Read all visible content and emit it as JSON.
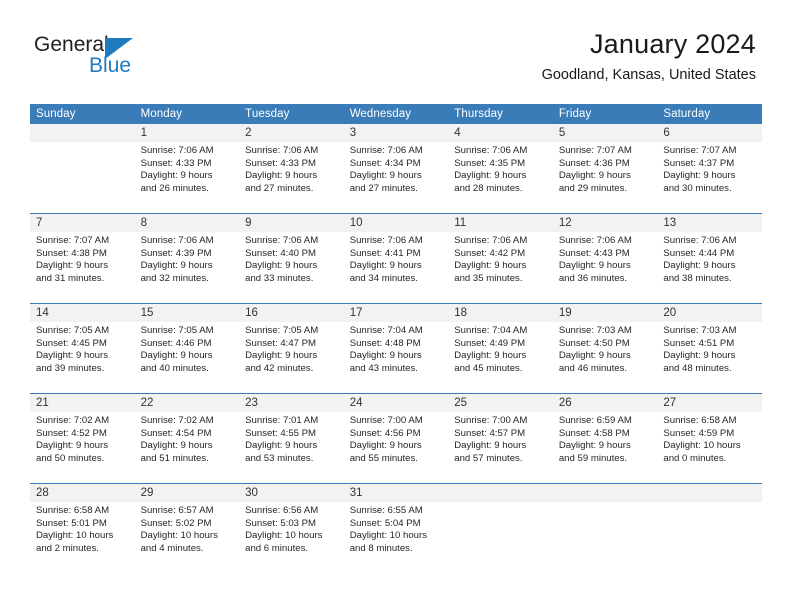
{
  "brand": {
    "name_part1": "General",
    "name_part2": "Blue",
    "accent_color": "#1f7ac0",
    "triangle_icon": "triangle-icon"
  },
  "header": {
    "title": "January 2024",
    "location": "Goodland, Kansas, United States"
  },
  "calendar": {
    "header_bg": "#3a7cb8",
    "daynum_bg": "#f2f2f2",
    "weekdays": [
      "Sunday",
      "Monday",
      "Tuesday",
      "Wednesday",
      "Thursday",
      "Friday",
      "Saturday"
    ],
    "weeks": [
      [
        {
          "day": "",
          "lines": []
        },
        {
          "day": "1",
          "lines": [
            "Sunrise: 7:06 AM",
            "Sunset: 4:33 PM",
            "Daylight: 9 hours",
            "and 26 minutes."
          ]
        },
        {
          "day": "2",
          "lines": [
            "Sunrise: 7:06 AM",
            "Sunset: 4:33 PM",
            "Daylight: 9 hours",
            "and 27 minutes."
          ]
        },
        {
          "day": "3",
          "lines": [
            "Sunrise: 7:06 AM",
            "Sunset: 4:34 PM",
            "Daylight: 9 hours",
            "and 27 minutes."
          ]
        },
        {
          "day": "4",
          "lines": [
            "Sunrise: 7:06 AM",
            "Sunset: 4:35 PM",
            "Daylight: 9 hours",
            "and 28 minutes."
          ]
        },
        {
          "day": "5",
          "lines": [
            "Sunrise: 7:07 AM",
            "Sunset: 4:36 PM",
            "Daylight: 9 hours",
            "and 29 minutes."
          ]
        },
        {
          "day": "6",
          "lines": [
            "Sunrise: 7:07 AM",
            "Sunset: 4:37 PM",
            "Daylight: 9 hours",
            "and 30 minutes."
          ]
        }
      ],
      [
        {
          "day": "7",
          "lines": [
            "Sunrise: 7:07 AM",
            "Sunset: 4:38 PM",
            "Daylight: 9 hours",
            "and 31 minutes."
          ]
        },
        {
          "day": "8",
          "lines": [
            "Sunrise: 7:06 AM",
            "Sunset: 4:39 PM",
            "Daylight: 9 hours",
            "and 32 minutes."
          ]
        },
        {
          "day": "9",
          "lines": [
            "Sunrise: 7:06 AM",
            "Sunset: 4:40 PM",
            "Daylight: 9 hours",
            "and 33 minutes."
          ]
        },
        {
          "day": "10",
          "lines": [
            "Sunrise: 7:06 AM",
            "Sunset: 4:41 PM",
            "Daylight: 9 hours",
            "and 34 minutes."
          ]
        },
        {
          "day": "11",
          "lines": [
            "Sunrise: 7:06 AM",
            "Sunset: 4:42 PM",
            "Daylight: 9 hours",
            "and 35 minutes."
          ]
        },
        {
          "day": "12",
          "lines": [
            "Sunrise: 7:06 AM",
            "Sunset: 4:43 PM",
            "Daylight: 9 hours",
            "and 36 minutes."
          ]
        },
        {
          "day": "13",
          "lines": [
            "Sunrise: 7:06 AM",
            "Sunset: 4:44 PM",
            "Daylight: 9 hours",
            "and 38 minutes."
          ]
        }
      ],
      [
        {
          "day": "14",
          "lines": [
            "Sunrise: 7:05 AM",
            "Sunset: 4:45 PM",
            "Daylight: 9 hours",
            "and 39 minutes."
          ]
        },
        {
          "day": "15",
          "lines": [
            "Sunrise: 7:05 AM",
            "Sunset: 4:46 PM",
            "Daylight: 9 hours",
            "and 40 minutes."
          ]
        },
        {
          "day": "16",
          "lines": [
            "Sunrise: 7:05 AM",
            "Sunset: 4:47 PM",
            "Daylight: 9 hours",
            "and 42 minutes."
          ]
        },
        {
          "day": "17",
          "lines": [
            "Sunrise: 7:04 AM",
            "Sunset: 4:48 PM",
            "Daylight: 9 hours",
            "and 43 minutes."
          ]
        },
        {
          "day": "18",
          "lines": [
            "Sunrise: 7:04 AM",
            "Sunset: 4:49 PM",
            "Daylight: 9 hours",
            "and 45 minutes."
          ]
        },
        {
          "day": "19",
          "lines": [
            "Sunrise: 7:03 AM",
            "Sunset: 4:50 PM",
            "Daylight: 9 hours",
            "and 46 minutes."
          ]
        },
        {
          "day": "20",
          "lines": [
            "Sunrise: 7:03 AM",
            "Sunset: 4:51 PM",
            "Daylight: 9 hours",
            "and 48 minutes."
          ]
        }
      ],
      [
        {
          "day": "21",
          "lines": [
            "Sunrise: 7:02 AM",
            "Sunset: 4:52 PM",
            "Daylight: 9 hours",
            "and 50 minutes."
          ]
        },
        {
          "day": "22",
          "lines": [
            "Sunrise: 7:02 AM",
            "Sunset: 4:54 PM",
            "Daylight: 9 hours",
            "and 51 minutes."
          ]
        },
        {
          "day": "23",
          "lines": [
            "Sunrise: 7:01 AM",
            "Sunset: 4:55 PM",
            "Daylight: 9 hours",
            "and 53 minutes."
          ]
        },
        {
          "day": "24",
          "lines": [
            "Sunrise: 7:00 AM",
            "Sunset: 4:56 PM",
            "Daylight: 9 hours",
            "and 55 minutes."
          ]
        },
        {
          "day": "25",
          "lines": [
            "Sunrise: 7:00 AM",
            "Sunset: 4:57 PM",
            "Daylight: 9 hours",
            "and 57 minutes."
          ]
        },
        {
          "day": "26",
          "lines": [
            "Sunrise: 6:59 AM",
            "Sunset: 4:58 PM",
            "Daylight: 9 hours",
            "and 59 minutes."
          ]
        },
        {
          "day": "27",
          "lines": [
            "Sunrise: 6:58 AM",
            "Sunset: 4:59 PM",
            "Daylight: 10 hours",
            "and 0 minutes."
          ]
        }
      ],
      [
        {
          "day": "28",
          "lines": [
            "Sunrise: 6:58 AM",
            "Sunset: 5:01 PM",
            "Daylight: 10 hours",
            "and 2 minutes."
          ]
        },
        {
          "day": "29",
          "lines": [
            "Sunrise: 6:57 AM",
            "Sunset: 5:02 PM",
            "Daylight: 10 hours",
            "and 4 minutes."
          ]
        },
        {
          "day": "30",
          "lines": [
            "Sunrise: 6:56 AM",
            "Sunset: 5:03 PM",
            "Daylight: 10 hours",
            "and 6 minutes."
          ]
        },
        {
          "day": "31",
          "lines": [
            "Sunrise: 6:55 AM",
            "Sunset: 5:04 PM",
            "Daylight: 10 hours",
            "and 8 minutes."
          ]
        },
        {
          "day": "",
          "lines": []
        },
        {
          "day": "",
          "lines": []
        },
        {
          "day": "",
          "lines": []
        }
      ]
    ]
  }
}
